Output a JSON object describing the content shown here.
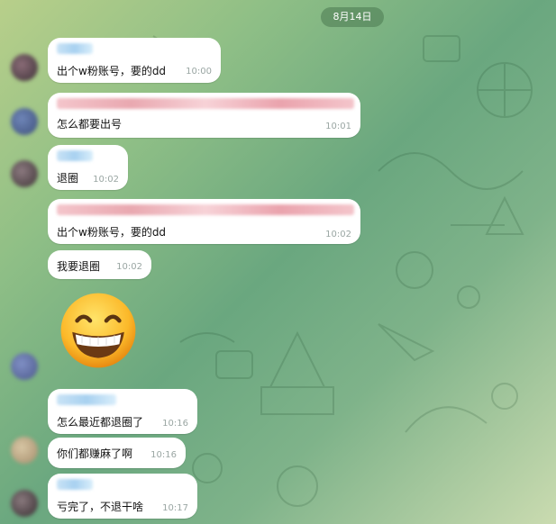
{
  "date_label": "8月14日",
  "messages": [
    {
      "text": "出个w粉账号，要的dd",
      "time": "10:00"
    },
    {
      "text": "怎么都要出号",
      "time": "10:01"
    },
    {
      "text": "退圈",
      "time": "10:02"
    },
    {
      "text": "出个w粉账号，要的dd",
      "time": "10:02"
    },
    {
      "text": "我要退圈",
      "time": "10:02"
    },
    {
      "text": "怎么最近都退圈了",
      "time": "10:16"
    },
    {
      "text": "你们都赚麻了啊",
      "time": "10:16"
    },
    {
      "text": "亏完了，不退干啥",
      "time": "10:17"
    }
  ],
  "sticker": {
    "icon": "grinning-face-icon"
  },
  "colors": {
    "bubble": "#ffffff",
    "time": "#9aa6a3",
    "date_pill": "#4a7850"
  }
}
